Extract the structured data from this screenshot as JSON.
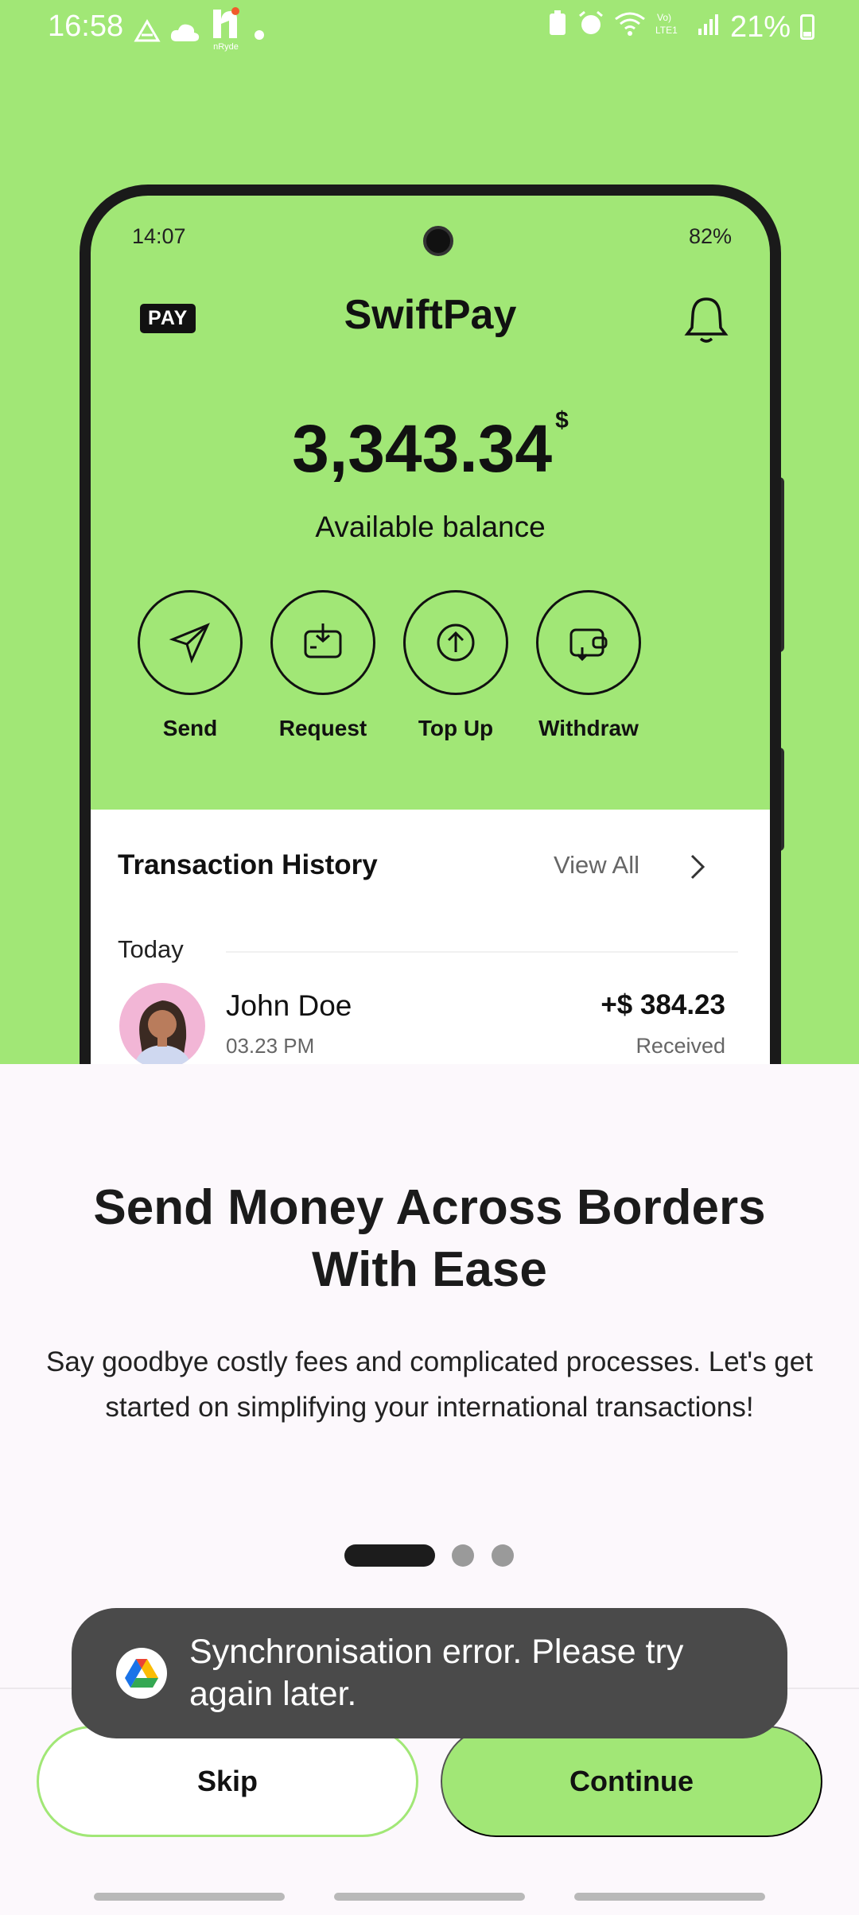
{
  "status_bar": {
    "time": "16:58",
    "left_icons": [
      "drive-icon",
      "cloud-icon",
      "nryde-app-icon",
      "dot-icon"
    ],
    "right_icons": [
      "battery-saver-icon",
      "alarm-icon",
      "wifi-icon",
      "volte-icon",
      "signal-icon"
    ],
    "battery": "21%"
  },
  "phone_mockup": {
    "status": {
      "time": "14:07",
      "battery": "82%"
    },
    "logo_text": "PAY",
    "app_title": "SwiftPay",
    "balance": "3,343.34",
    "currency": "$",
    "balance_label": "Available balance",
    "actions": [
      {
        "label": "Send",
        "icon": "send-icon"
      },
      {
        "label": "Request",
        "icon": "request-icon"
      },
      {
        "label": "Top Up",
        "icon": "top-up-icon"
      },
      {
        "label": "Withdraw",
        "icon": "withdraw-icon"
      }
    ],
    "transactions": {
      "title": "Transaction History",
      "view_all": "View All",
      "group_label": "Today",
      "items": [
        {
          "name": "John Doe",
          "time": "03.23 PM",
          "amount": "+$ 384.23",
          "status": "Received"
        }
      ]
    }
  },
  "onboarding": {
    "headline": "Send Money Across Borders With Ease",
    "body": "Say goodbye costly fees and complicated processes. Let's get started on simplifying your international transactions!",
    "page_count": 3,
    "active_page": 1
  },
  "buttons": {
    "skip": "Skip",
    "continue": "Continue"
  },
  "toast": {
    "message": "Synchronisation error. Please try again later."
  },
  "colors": {
    "accent": "#a1e776",
    "background": "#fcf8fc",
    "toast": "#4a4a4a"
  }
}
